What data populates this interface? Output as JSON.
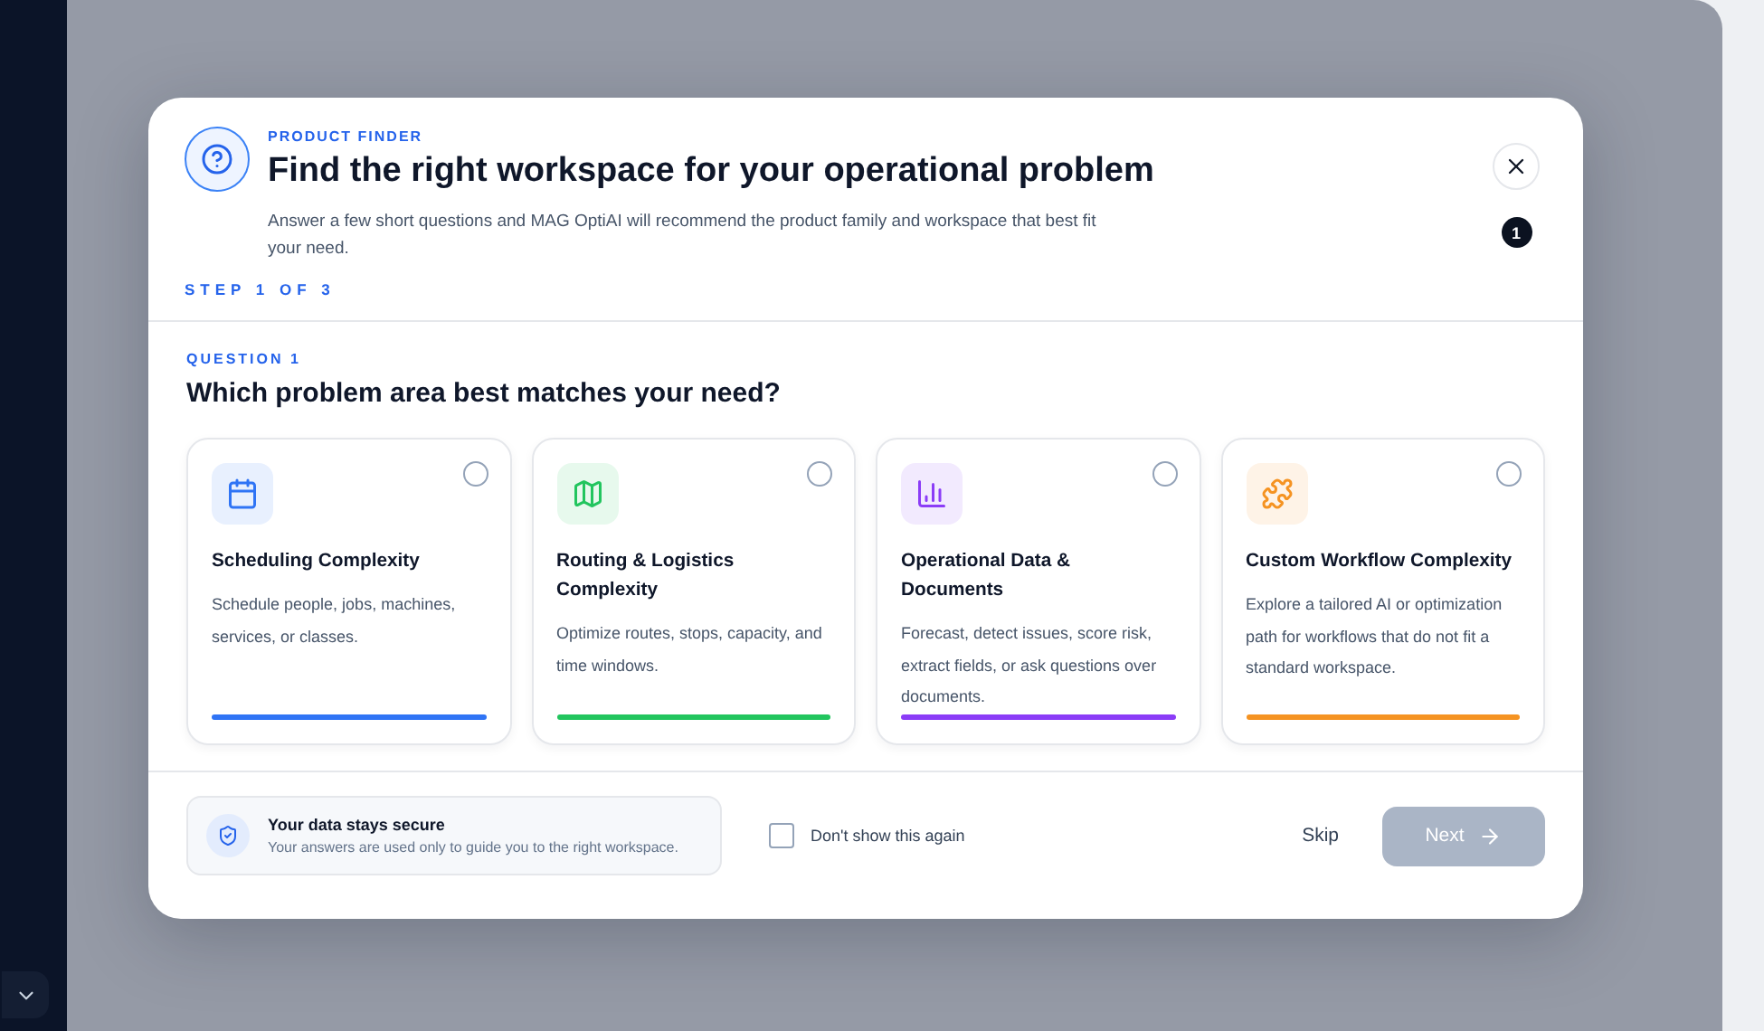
{
  "dialog": {
    "eyebrow": "PRODUCT FINDER",
    "title": "Find the right workspace for your operational problem",
    "description": "Answer a few short questions and MAG OptiAI will recommend the product family and workspace that best fit your need.",
    "step": "STEP 1 OF 3",
    "badge": "1"
  },
  "question": {
    "label": "QUESTION 1",
    "text": "Which problem area best matches your need?"
  },
  "options": [
    {
      "kind": "calendar",
      "title": "Scheduling Complexity",
      "description": "Schedule people, jobs, machines, services, or classes.",
      "color": "#2f74f5",
      "selected": false
    },
    {
      "kind": "map",
      "title": "Routing & Logistics Complexity",
      "description": "Optimize routes, stops, capacity, and time windows.",
      "color": "#22c55e",
      "selected": false
    },
    {
      "kind": "chart",
      "title": "Operational Data & Documents",
      "description": "Forecast, detect issues, score risk, extract fields, or ask questions over documents.",
      "color": "#8b3cf7",
      "selected": false
    },
    {
      "kind": "puzzle",
      "title": "Custom Workflow Complexity",
      "description": "Explore a tailored AI or optimization path for workflows that do not fit a standard workspace.",
      "color": "#f59322",
      "selected": false
    }
  ],
  "footer": {
    "security_title": "Your data stays secure",
    "security_text": "Your answers are used only to guide you to the right workspace.",
    "checkbox": {
      "label": "Don't show this again",
      "checked": false
    },
    "skip": "Skip",
    "next": {
      "label": "Next",
      "disabled": true
    }
  }
}
